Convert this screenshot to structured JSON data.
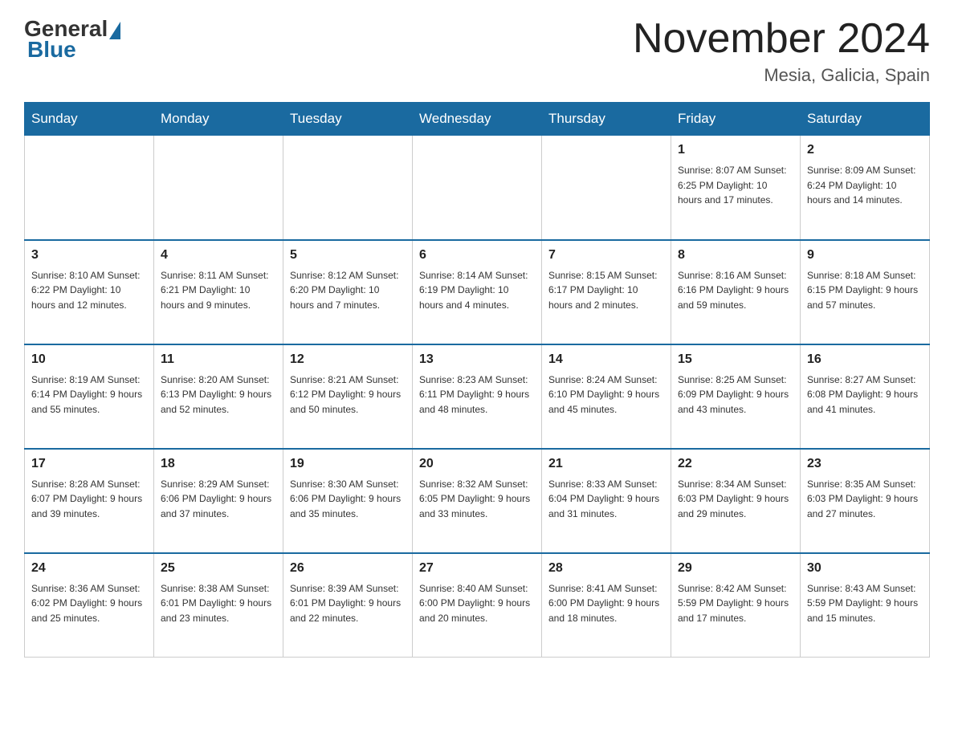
{
  "logo": {
    "general": "General",
    "blue": "Blue"
  },
  "header": {
    "month_year": "November 2024",
    "location": "Mesia, Galicia, Spain"
  },
  "weekdays": [
    "Sunday",
    "Monday",
    "Tuesday",
    "Wednesday",
    "Thursday",
    "Friday",
    "Saturday"
  ],
  "rows": [
    [
      {
        "day": "",
        "info": ""
      },
      {
        "day": "",
        "info": ""
      },
      {
        "day": "",
        "info": ""
      },
      {
        "day": "",
        "info": ""
      },
      {
        "day": "",
        "info": ""
      },
      {
        "day": "1",
        "info": "Sunrise: 8:07 AM\nSunset: 6:25 PM\nDaylight: 10 hours\nand 17 minutes."
      },
      {
        "day": "2",
        "info": "Sunrise: 8:09 AM\nSunset: 6:24 PM\nDaylight: 10 hours\nand 14 minutes."
      }
    ],
    [
      {
        "day": "3",
        "info": "Sunrise: 8:10 AM\nSunset: 6:22 PM\nDaylight: 10 hours\nand 12 minutes."
      },
      {
        "day": "4",
        "info": "Sunrise: 8:11 AM\nSunset: 6:21 PM\nDaylight: 10 hours\nand 9 minutes."
      },
      {
        "day": "5",
        "info": "Sunrise: 8:12 AM\nSunset: 6:20 PM\nDaylight: 10 hours\nand 7 minutes."
      },
      {
        "day": "6",
        "info": "Sunrise: 8:14 AM\nSunset: 6:19 PM\nDaylight: 10 hours\nand 4 minutes."
      },
      {
        "day": "7",
        "info": "Sunrise: 8:15 AM\nSunset: 6:17 PM\nDaylight: 10 hours\nand 2 minutes."
      },
      {
        "day": "8",
        "info": "Sunrise: 8:16 AM\nSunset: 6:16 PM\nDaylight: 9 hours\nand 59 minutes."
      },
      {
        "day": "9",
        "info": "Sunrise: 8:18 AM\nSunset: 6:15 PM\nDaylight: 9 hours\nand 57 minutes."
      }
    ],
    [
      {
        "day": "10",
        "info": "Sunrise: 8:19 AM\nSunset: 6:14 PM\nDaylight: 9 hours\nand 55 minutes."
      },
      {
        "day": "11",
        "info": "Sunrise: 8:20 AM\nSunset: 6:13 PM\nDaylight: 9 hours\nand 52 minutes."
      },
      {
        "day": "12",
        "info": "Sunrise: 8:21 AM\nSunset: 6:12 PM\nDaylight: 9 hours\nand 50 minutes."
      },
      {
        "day": "13",
        "info": "Sunrise: 8:23 AM\nSunset: 6:11 PM\nDaylight: 9 hours\nand 48 minutes."
      },
      {
        "day": "14",
        "info": "Sunrise: 8:24 AM\nSunset: 6:10 PM\nDaylight: 9 hours\nand 45 minutes."
      },
      {
        "day": "15",
        "info": "Sunrise: 8:25 AM\nSunset: 6:09 PM\nDaylight: 9 hours\nand 43 minutes."
      },
      {
        "day": "16",
        "info": "Sunrise: 8:27 AM\nSunset: 6:08 PM\nDaylight: 9 hours\nand 41 minutes."
      }
    ],
    [
      {
        "day": "17",
        "info": "Sunrise: 8:28 AM\nSunset: 6:07 PM\nDaylight: 9 hours\nand 39 minutes."
      },
      {
        "day": "18",
        "info": "Sunrise: 8:29 AM\nSunset: 6:06 PM\nDaylight: 9 hours\nand 37 minutes."
      },
      {
        "day": "19",
        "info": "Sunrise: 8:30 AM\nSunset: 6:06 PM\nDaylight: 9 hours\nand 35 minutes."
      },
      {
        "day": "20",
        "info": "Sunrise: 8:32 AM\nSunset: 6:05 PM\nDaylight: 9 hours\nand 33 minutes."
      },
      {
        "day": "21",
        "info": "Sunrise: 8:33 AM\nSunset: 6:04 PM\nDaylight: 9 hours\nand 31 minutes."
      },
      {
        "day": "22",
        "info": "Sunrise: 8:34 AM\nSunset: 6:03 PM\nDaylight: 9 hours\nand 29 minutes."
      },
      {
        "day": "23",
        "info": "Sunrise: 8:35 AM\nSunset: 6:03 PM\nDaylight: 9 hours\nand 27 minutes."
      }
    ],
    [
      {
        "day": "24",
        "info": "Sunrise: 8:36 AM\nSunset: 6:02 PM\nDaylight: 9 hours\nand 25 minutes."
      },
      {
        "day": "25",
        "info": "Sunrise: 8:38 AM\nSunset: 6:01 PM\nDaylight: 9 hours\nand 23 minutes."
      },
      {
        "day": "26",
        "info": "Sunrise: 8:39 AM\nSunset: 6:01 PM\nDaylight: 9 hours\nand 22 minutes."
      },
      {
        "day": "27",
        "info": "Sunrise: 8:40 AM\nSunset: 6:00 PM\nDaylight: 9 hours\nand 20 minutes."
      },
      {
        "day": "28",
        "info": "Sunrise: 8:41 AM\nSunset: 6:00 PM\nDaylight: 9 hours\nand 18 minutes."
      },
      {
        "day": "29",
        "info": "Sunrise: 8:42 AM\nSunset: 5:59 PM\nDaylight: 9 hours\nand 17 minutes."
      },
      {
        "day": "30",
        "info": "Sunrise: 8:43 AM\nSunset: 5:59 PM\nDaylight: 9 hours\nand 15 minutes."
      }
    ]
  ]
}
